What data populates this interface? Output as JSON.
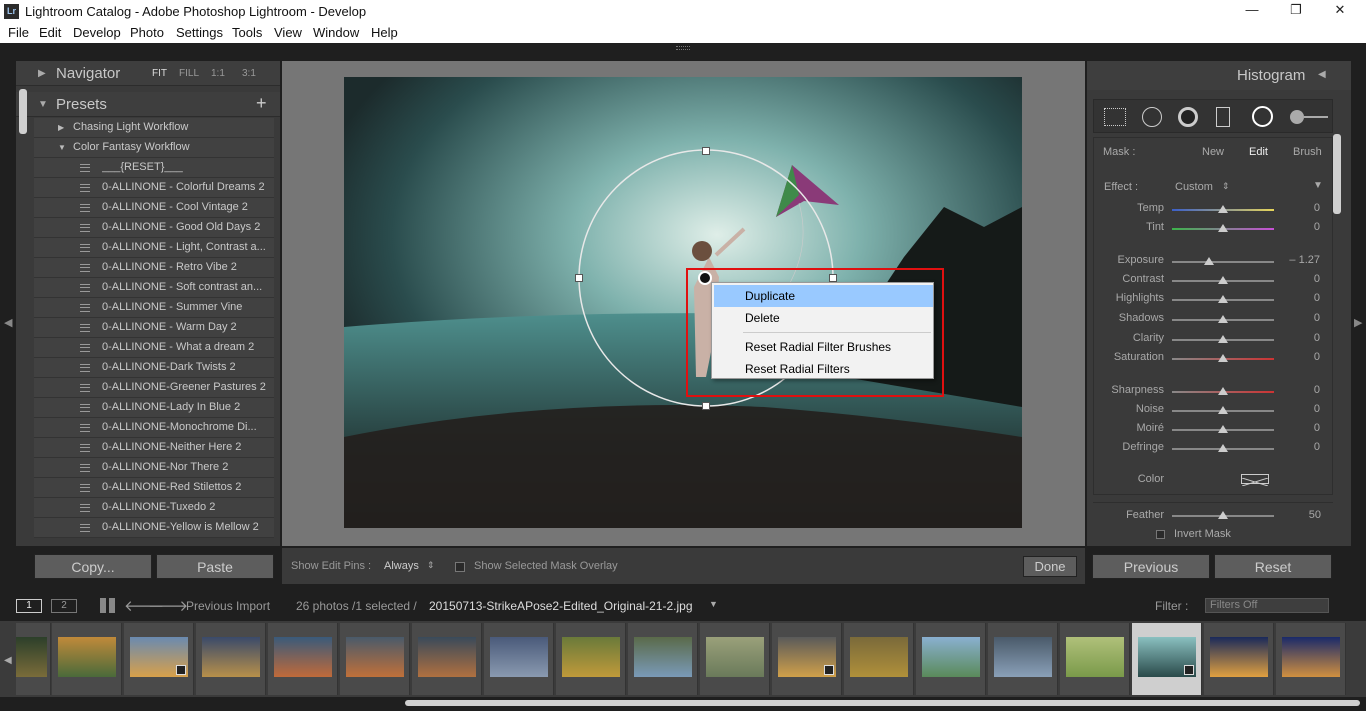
{
  "window": {
    "title": "Lightroom Catalog - Adobe Photoshop Lightroom - Develop",
    "logo": "Lr"
  },
  "menu": [
    "File",
    "Edit",
    "Develop",
    "Photo",
    "Settings",
    "Tools",
    "View",
    "Window",
    "Help"
  ],
  "navigator": {
    "label": "Navigator",
    "modes": [
      "FIT",
      "FILL",
      "1:1",
      "3:1"
    ]
  },
  "presets": {
    "label": "Presets",
    "add": "+",
    "folders": [
      "Chasing Light Workflow",
      "Color Fantasy Workflow"
    ],
    "items": [
      "___{RESET}___",
      "0-ALLINONE - Colorful Dreams 2",
      "0-ALLINONE - Cool Vintage 2",
      "0-ALLINONE - Good Old Days 2",
      "0-ALLINONE - Light, Contrast a...",
      "0-ALLINONE - Retro Vibe 2",
      "0-ALLINONE - Soft contrast an...",
      "0-ALLINONE - Summer Vine",
      "0-ALLINONE - Warm Day 2",
      "0-ALLINONE - What a dream 2",
      "0-ALLINONE-Dark Twists 2",
      "0-ALLINONE-Greener Pastures 2",
      "0-ALLINONE-Lady In Blue 2",
      "0-ALLINONE-Monochrome Di...",
      "0-ALLINONE-Neither Here 2",
      "0-ALLINONE-Nor There 2",
      "0-ALLINONE-Red Stilettos 2",
      "0-ALLINONE-Tuxedo 2",
      "0-ALLINONE-Yellow is Mellow 2"
    ]
  },
  "left_buttons": {
    "copy": "Copy...",
    "paste": "Paste"
  },
  "histogram": {
    "label": "Histogram"
  },
  "mask": {
    "label": "Mask :",
    "new": "New",
    "edit": "Edit",
    "brush": "Brush"
  },
  "effect": {
    "label": "Effect :",
    "value": "Custom"
  },
  "sliders": [
    {
      "label": "Temp",
      "value": "0",
      "pos": 0.5
    },
    {
      "label": "Tint",
      "value": "0",
      "pos": 0.5
    },
    {
      "label": "Exposure",
      "value": "– 1.27",
      "pos": 0.36
    },
    {
      "label": "Contrast",
      "value": "0",
      "pos": 0.5
    },
    {
      "label": "Highlights",
      "value": "0",
      "pos": 0.5
    },
    {
      "label": "Shadows",
      "value": "0",
      "pos": 0.5
    },
    {
      "label": "Clarity",
      "value": "0",
      "pos": 0.5
    },
    {
      "label": "Saturation",
      "value": "0",
      "pos": 0.5
    },
    {
      "label": "Sharpness",
      "value": "0",
      "pos": 0.5
    },
    {
      "label": "Noise",
      "value": "0",
      "pos": 0.5
    },
    {
      "label": "Moiré",
      "value": "0",
      "pos": 0.5
    },
    {
      "label": "Defringe",
      "value": "0",
      "pos": 0.5
    }
  ],
  "color": {
    "label": "Color"
  },
  "feather": {
    "label": "Feather",
    "value": "50",
    "pos": 0.5
  },
  "invert": {
    "label": "Invert Mask"
  },
  "right_buttons": {
    "previous": "Previous",
    "reset": "Reset"
  },
  "toolbar": {
    "pins_label": "Show Edit Pins :",
    "pins_value": "Always",
    "overlay": "Show Selected Mask Overlay",
    "done": "Done"
  },
  "context_menu": {
    "items": [
      "Duplicate",
      "Delete",
      "Reset Radial Filter Brushes",
      "Reset Radial Filters"
    ]
  },
  "filmstrip_bar": {
    "view1": "1",
    "view2": "2",
    "source": "Previous Import",
    "count": "26 photos /1 selected /",
    "filename": "20150713-StrikeAPose2-Edited_Original-21-2.jpg",
    "filter_label": "Filter :",
    "filter_value": "Filters Off"
  },
  "colors": {
    "highlight": "#99c9ff",
    "annotation": "#e01010",
    "panel": "#3a3a3a"
  }
}
